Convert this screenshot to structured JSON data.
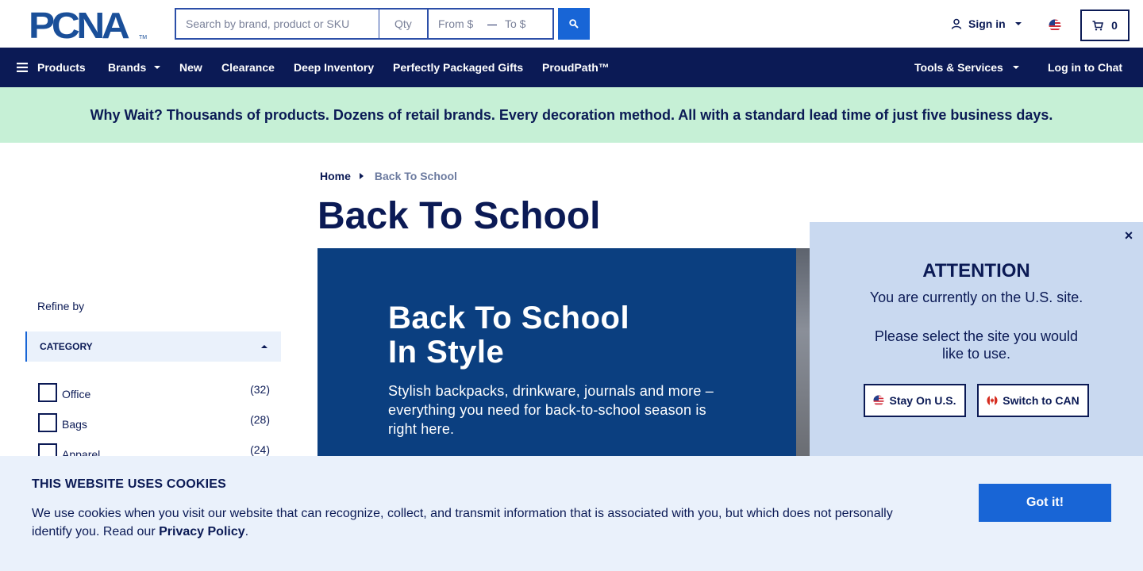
{
  "header": {
    "logo_text": "PCNA",
    "logo_tm": "TM",
    "search_placeholder": "Search by brand, product or SKU",
    "qty_placeholder": "Qty",
    "from_placeholder": "From $",
    "range_dash": "—",
    "to_placeholder": "To $",
    "signin_label": "Sign in",
    "cart_count": "0"
  },
  "nav": {
    "products": "Products",
    "brands": "Brands",
    "new": "New",
    "clearance": "Clearance",
    "deep_inventory": "Deep Inventory",
    "gifts": "Perfectly Packaged Gifts",
    "proudpath": "ProudPath™",
    "tools": "Tools & Services",
    "chat": "Log in to Chat"
  },
  "promo": {
    "text": "Why Wait? Thousands of products. Dozens of retail brands. Every decoration method. All with a standard lead time of just five business days."
  },
  "breadcrumb": {
    "home": "Home",
    "current": "Back To School"
  },
  "page": {
    "title": "Back To School"
  },
  "sidebar": {
    "refine_label": "Refine by",
    "category_header": "CATEGORY",
    "categories": [
      {
        "label": "Office",
        "count": "(32)"
      },
      {
        "label": "Bags",
        "count": "(28)"
      },
      {
        "label": "Apparel",
        "count": "(24)"
      }
    ]
  },
  "banner": {
    "title_line1": "Back To School",
    "title_line2": "In Style",
    "subtitle": "Stylish backpacks, drinkware, journals and more – everything you need for back-to-school season is right here."
  },
  "attention": {
    "close": "×",
    "title": "ATTENTION",
    "message": "You are currently on the U.S. site.",
    "prompt": "Please select the site you would like to use.",
    "stay_label": "Stay On U.S.",
    "switch_label": "Switch to CAN"
  },
  "cookie": {
    "title": "THIS WEBSITE USES COOKIES",
    "text": "We use cookies when you visit our website that can recognize, collect, and transmit information that is associated with you, but which does not personally identify you. Read our",
    "link": "Privacy Policy",
    "period": ".",
    "button": "Got it!"
  },
  "colors": {
    "navy": "#0b1a55",
    "brand_blue": "#1865d6",
    "promo_green": "#c6f0d6",
    "banner_blue": "#0b3f80",
    "modal_bg": "#c9d9f0",
    "cookie_bg": "#eaf1fb"
  },
  "icons": [
    "search-icon",
    "user-icon",
    "us-flag-icon",
    "cart-icon",
    "hamburger-icon",
    "chevron-down-icon",
    "caret-right-icon",
    "caret-up-icon",
    "close-icon",
    "ca-flag-icon"
  ]
}
